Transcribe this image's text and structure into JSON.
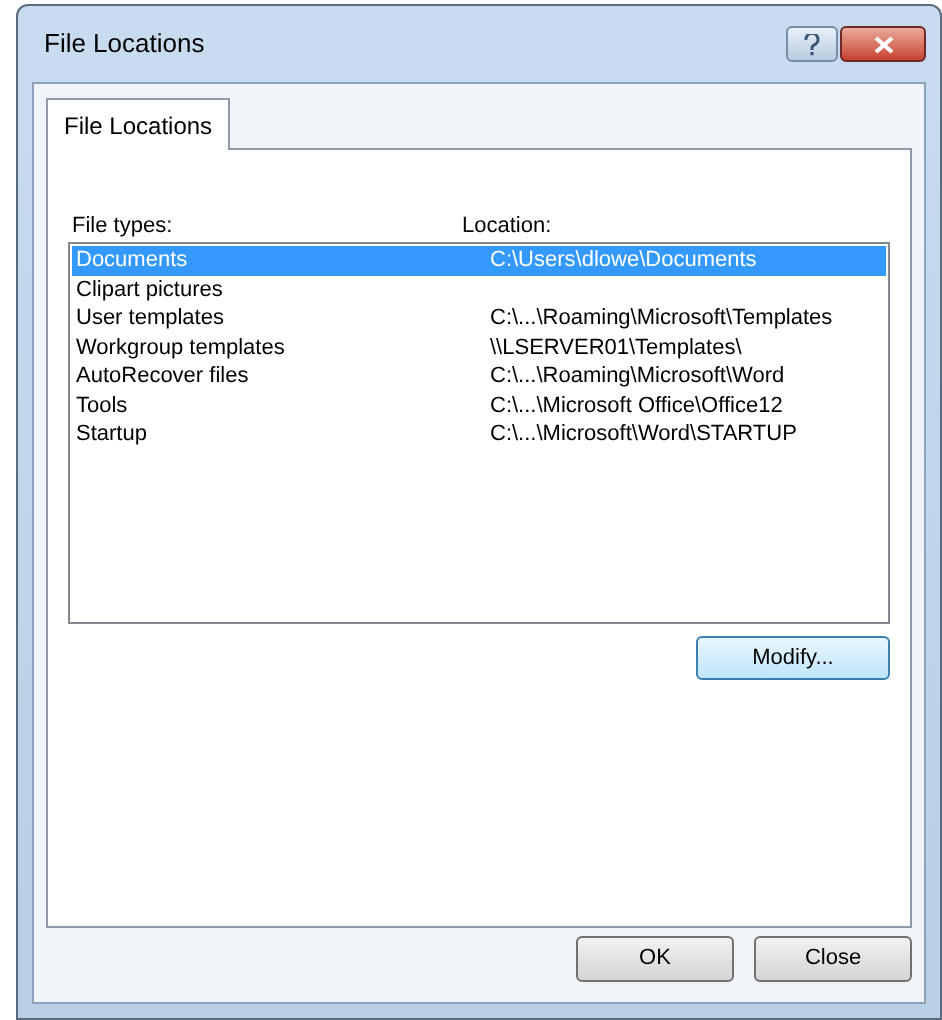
{
  "window": {
    "title": "File Locations"
  },
  "tabs": [
    {
      "label": "File Locations",
      "selected": true
    }
  ],
  "list": {
    "columns": [
      "File types:",
      "Location:"
    ],
    "rows": [
      {
        "type": "Documents",
        "location": "C:\\Users\\dlowe\\Documents",
        "selected": true
      },
      {
        "type": "Clipart pictures",
        "location": "",
        "selected": false
      },
      {
        "type": "User templates",
        "location": "C:\\...\\Roaming\\Microsoft\\Templates",
        "selected": false
      },
      {
        "type": "Workgroup templates",
        "location": "\\\\LSERVER01\\Templates\\",
        "selected": false
      },
      {
        "type": "AutoRecover files",
        "location": "C:\\...\\Roaming\\Microsoft\\Word",
        "selected": false
      },
      {
        "type": "Tools",
        "location": "C:\\...\\Microsoft Office\\Office12",
        "selected": false
      },
      {
        "type": "Startup",
        "location": "C:\\...\\Microsoft\\Word\\STARTUP",
        "selected": false
      }
    ]
  },
  "modify_button": "Modify...",
  "buttons": [
    "OK",
    "Close"
  ]
}
